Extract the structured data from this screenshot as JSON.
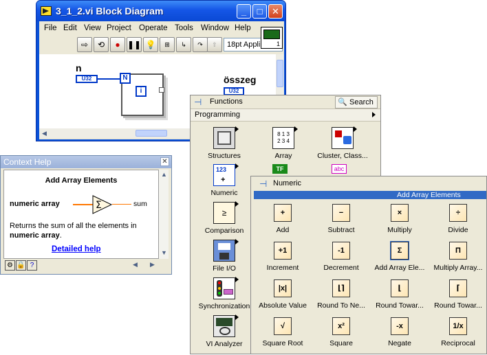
{
  "block_diagram": {
    "title": "3_1_2.vi Block Diagram",
    "menu": [
      "File",
      "Edit",
      "View",
      "Project",
      "Operate",
      "Tools",
      "Window",
      "Help"
    ],
    "font": "18pt Appli",
    "vi_icon_number": "1",
    "canvas": {
      "control_label": "n",
      "control_type": "U32",
      "count_terminal": "N",
      "iteration_terminal": "i",
      "indicator_label": "összeg",
      "indicator_type": "U32"
    }
  },
  "context_help": {
    "title": "Context Help",
    "function_name": "Add Array Elements",
    "input_label": "numeric array",
    "output_label": "sum",
    "description_prefix": "Returns the sum of all the elements in",
    "description_bold": "numeric array",
    "description_suffix": ".",
    "link": "Detailed help"
  },
  "functions_palette": {
    "title": "Functions",
    "search_label": "Search",
    "category": "Programming",
    "items": [
      {
        "label": "Structures",
        "icon": "structures-icon"
      },
      {
        "label": "Array",
        "icon": "array-icon"
      },
      {
        "label": "Cluster, Class...",
        "icon": "cluster-icon"
      },
      {
        "label": "Numeric",
        "icon": "numeric-icon"
      },
      {
        "label": "Comparison",
        "icon": "comparison-icon"
      },
      {
        "label": "File I/O",
        "icon": "file-io-icon"
      },
      {
        "label": "Synchronization",
        "icon": "synchronization-icon"
      },
      {
        "label": "VI Analyzer",
        "icon": "vi-analyzer-icon"
      }
    ],
    "partial_icons": [
      "TF",
      "abc"
    ]
  },
  "numeric_palette": {
    "title": "Numeric",
    "selected_label": "Add Array Elements",
    "items": [
      {
        "label": "Add",
        "glyph": "+"
      },
      {
        "label": "Subtract",
        "glyph": "−"
      },
      {
        "label": "Multiply",
        "glyph": "×"
      },
      {
        "label": "Divide",
        "glyph": "÷"
      },
      {
        "label": "Increment",
        "glyph": "+1"
      },
      {
        "label": "Decrement",
        "glyph": "-1"
      },
      {
        "label": "Add Array Ele...",
        "glyph": "Σ"
      },
      {
        "label": "Multiply Array...",
        "glyph": "Π"
      },
      {
        "label": "Absolute Value",
        "glyph": "|x|"
      },
      {
        "label": "Round To Ne...",
        "glyph": "⌊⌉"
      },
      {
        "label": "Round Towar...",
        "glyph": "⌊"
      },
      {
        "label": "Round Towar...",
        "glyph": "⌈"
      },
      {
        "label": "Square Root",
        "glyph": "√"
      },
      {
        "label": "Square",
        "glyph": "x²"
      },
      {
        "label": "Negate",
        "glyph": "-x"
      },
      {
        "label": "Reciprocal",
        "glyph": "1/x"
      }
    ]
  },
  "colors": {
    "titlebar": "#0a52d8",
    "selection": "#316ac5",
    "terminal_blue": "#0038c8",
    "wire_orange": "#ff7700",
    "link": "#0000ff"
  }
}
